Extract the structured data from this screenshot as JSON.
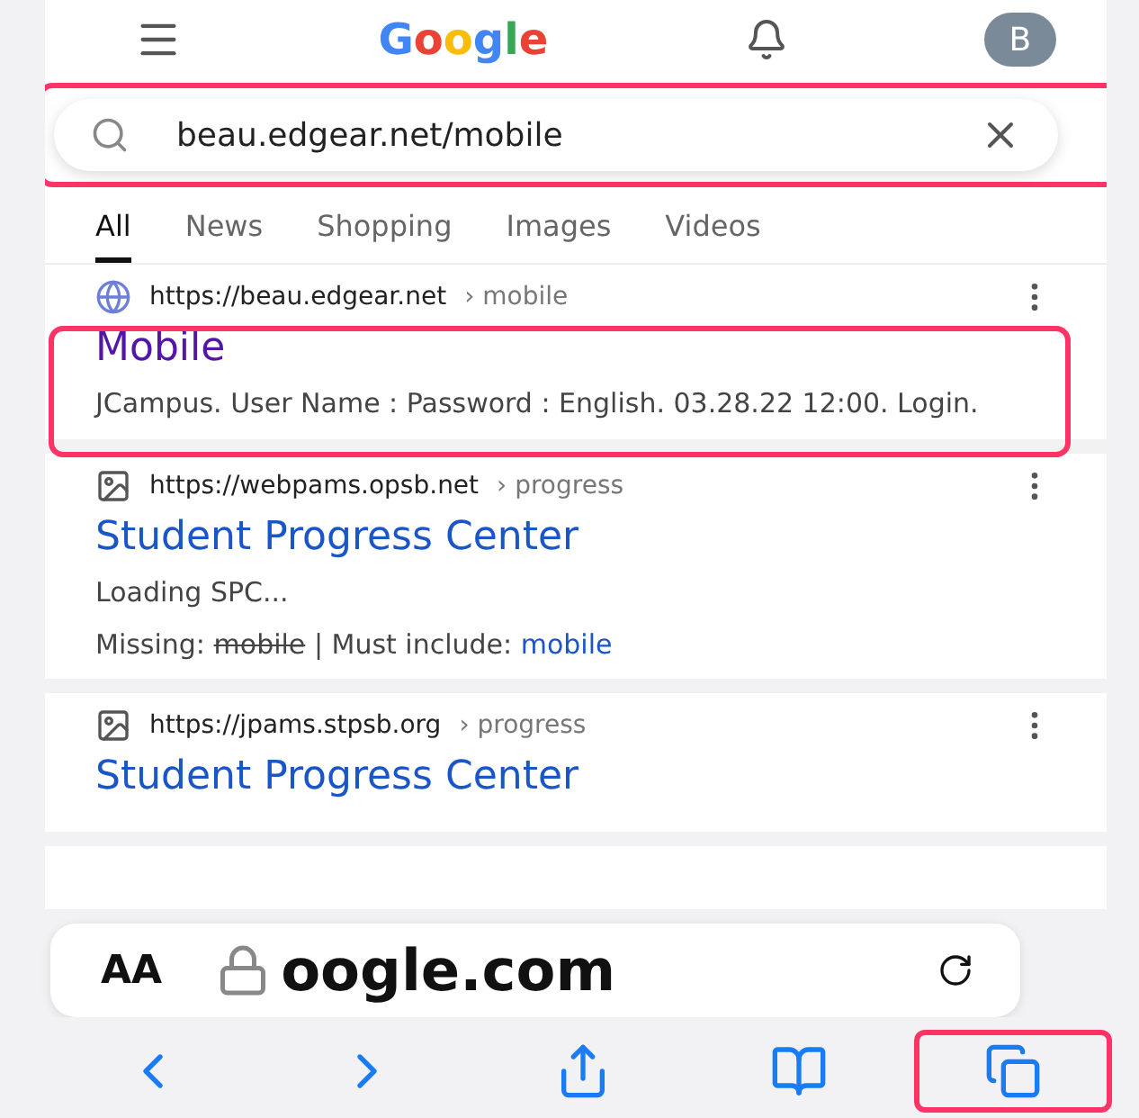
{
  "header": {
    "logo": "Google",
    "avatar": "B"
  },
  "search": {
    "value": "beau.edgear.net/mobile",
    "highlighted": true
  },
  "tabs": [
    {
      "label": "All",
      "selected": true
    },
    {
      "label": "News",
      "selected": false
    },
    {
      "label": "Shopping",
      "selected": false
    },
    {
      "label": "Images",
      "selected": false
    },
    {
      "label": "Videos",
      "selected": false
    }
  ],
  "results": [
    {
      "kind": "globe",
      "url": "https://beau.edgear.net",
      "path": "› mobile",
      "title": "Mobile",
      "visited": true,
      "highlighted": true,
      "snippet": "JCampus. User Name : Password : English. 03.28.22 12:00. Login."
    },
    {
      "kind": "image",
      "url": "https://webpams.opsb.net",
      "path": "› progress",
      "title": "Student Progress Center",
      "visited": false,
      "highlighted": false,
      "snippet": "Loading SPC...",
      "missing": {
        "label": "Missing:",
        "struck": "mobile",
        "separator": "| Must include:",
        "term": "mobile"
      }
    },
    {
      "kind": "image",
      "url": "https://jpams.stpsb.org",
      "path": "› progress",
      "title": "Student Progress Center",
      "visited": false,
      "highlighted": false
    }
  ],
  "address_bar": {
    "text_size": "AA",
    "domain": "oogle.com"
  },
  "toolbar": [
    {
      "kind": "back",
      "highlighted": false
    },
    {
      "kind": "forward",
      "highlighted": false
    },
    {
      "kind": "share",
      "highlighted": false
    },
    {
      "kind": "bookmarks",
      "highlighted": false
    },
    {
      "kind": "tabs",
      "highlighted": true
    }
  ]
}
